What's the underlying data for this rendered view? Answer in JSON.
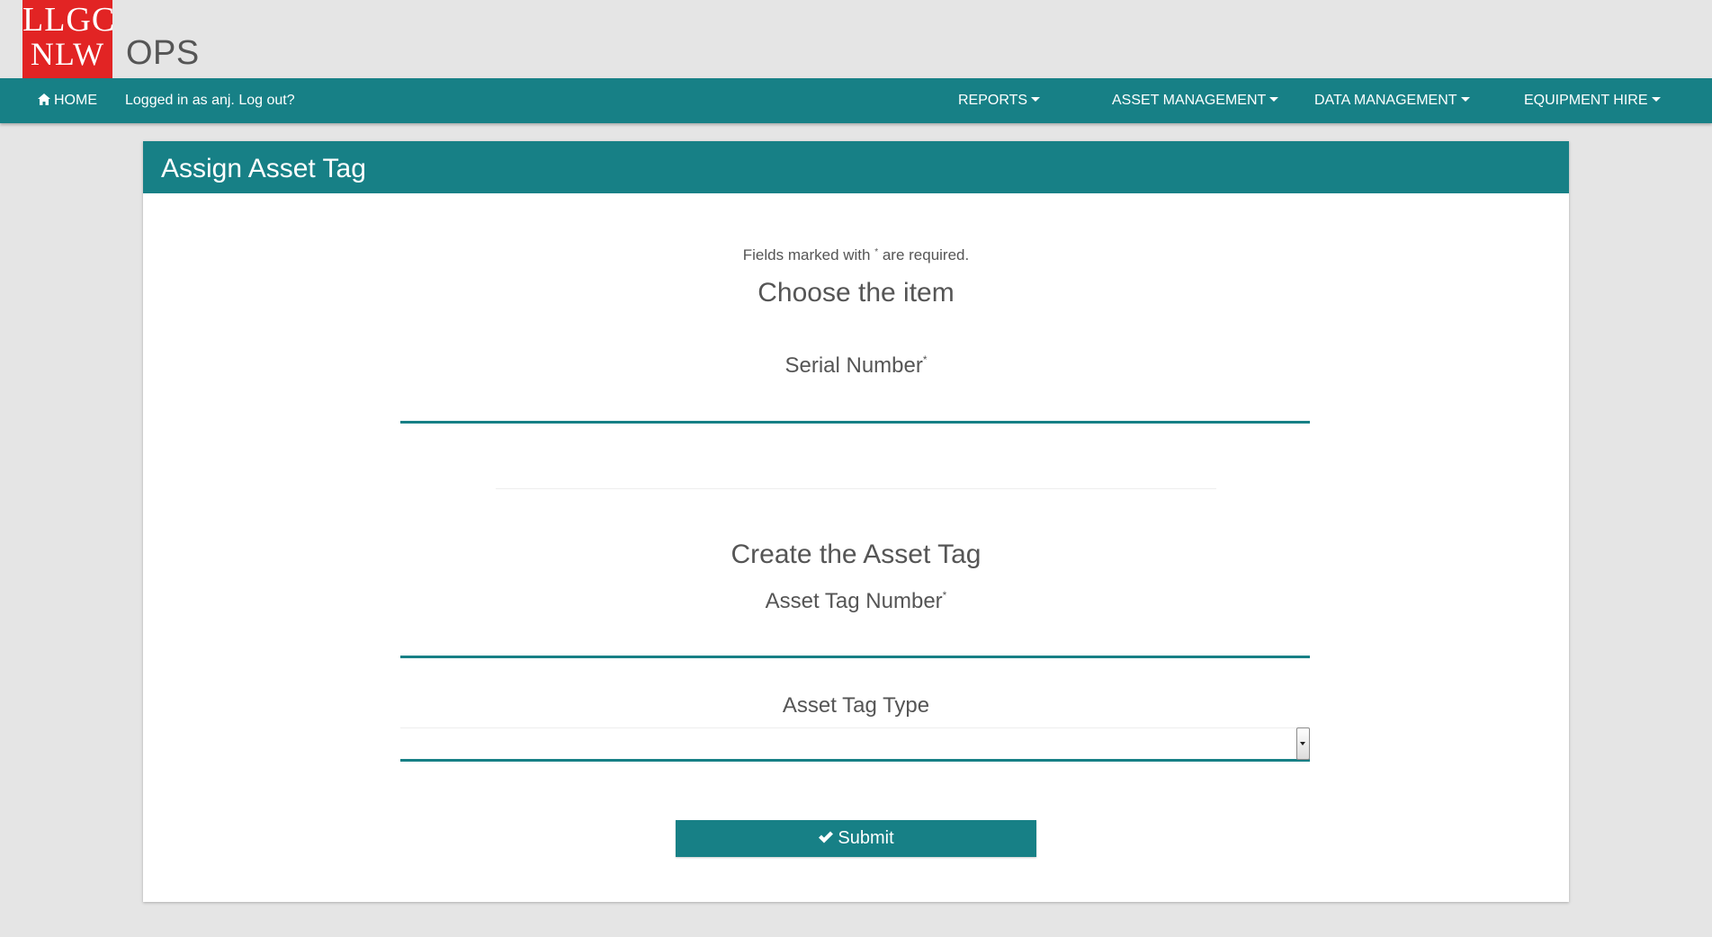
{
  "brand": {
    "logo_line1": "LLGC",
    "logo_line2": "NLW",
    "app_name": "OPS",
    "logo_color": "#e22424"
  },
  "navbar": {
    "home_label": "HOME",
    "home_icon": "home-icon",
    "login_status": "Logged in as anj. Log out?",
    "menus": [
      {
        "label": "REPORTS"
      },
      {
        "label": "ASSET MANAGEMENT"
      },
      {
        "label": "DATA MANAGEMENT"
      },
      {
        "label": "EQUIPMENT HIRE"
      }
    ],
    "color": "#178086"
  },
  "panel": {
    "title": "Assign Asset Tag",
    "required_note_prefix": "Fields marked with ",
    "required_mark": "*",
    "required_note_suffix": " are required.",
    "item_section": {
      "title": "Choose the item",
      "serial_label": "Serial Number",
      "serial_value": ""
    },
    "tag_section": {
      "title": "Create the Asset Tag",
      "tag_number_label": "Asset Tag Number",
      "tag_number_value": "",
      "tag_type_label": "Asset Tag Type",
      "tag_type_selected": ""
    },
    "submit_label": "Submit",
    "submit_icon": "check-icon"
  }
}
